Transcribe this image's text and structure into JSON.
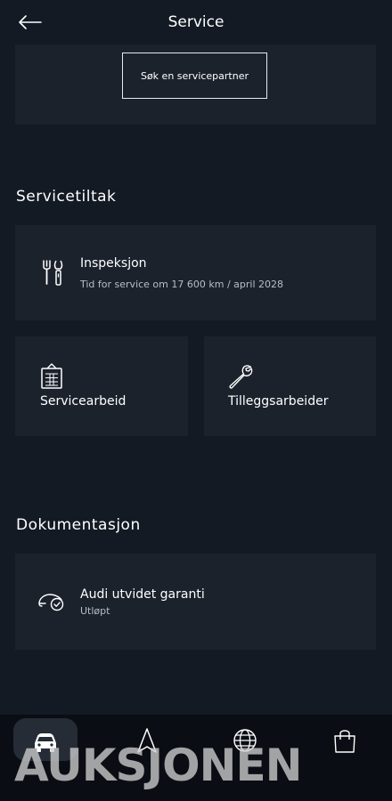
{
  "header": {
    "title": "Service",
    "back_icon": "arrow-left-icon"
  },
  "partner": {
    "button_label": "Søk en servicepartner"
  },
  "service_actions": {
    "title": "Servicetiltak",
    "inspection": {
      "label": "Inspeksjon",
      "detail": "Tid for service om 17 600 km / april 2028",
      "icon": "tools-icon"
    },
    "service_work": {
      "label": "Servicearbeid",
      "icon": "service-list-icon"
    },
    "additional_work": {
      "label": "Tilleggsarbeider",
      "icon": "wrench-icon"
    }
  },
  "documentation": {
    "title": "Dokumentasjon",
    "warranty": {
      "label": "Audi utvidet garanti",
      "status": "Utløpt",
      "icon": "car-warranty-icon"
    }
  },
  "bottom_nav": {
    "items": [
      {
        "icon": "car-icon",
        "active": true
      },
      {
        "icon": "navigation-icon",
        "active": false
      },
      {
        "icon": "globe-icon",
        "active": false
      },
      {
        "icon": "shopping-bag-icon",
        "active": false
      }
    ]
  },
  "watermark": "AUKSJONEN",
  "colors": {
    "background": "#131a24",
    "card": "#1b222c",
    "nav": "#0a0e14",
    "text": "#ffffff",
    "muted": "#b9bec5"
  }
}
